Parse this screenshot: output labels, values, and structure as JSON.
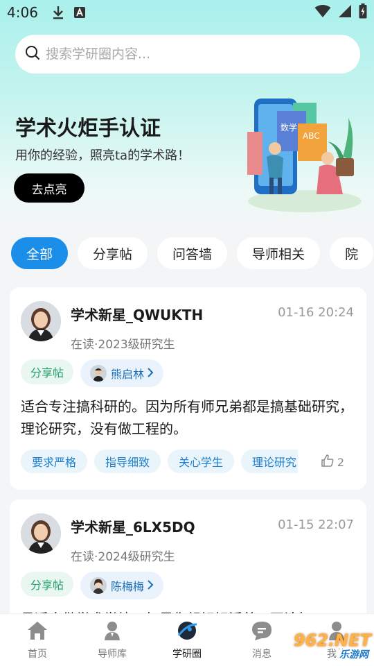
{
  "status_bar": {
    "time": "4:06"
  },
  "search": {
    "placeholder": "搜索学研圈内容..."
  },
  "banner": {
    "title": "学术火炬手认证",
    "subtitle": "用你的经验，照亮ta的学术路！",
    "button_label": "去点亮",
    "illustration_book1": "数学",
    "illustration_book2": "ABC"
  },
  "tabs": [
    {
      "label": "全部",
      "active": true
    },
    {
      "label": "分享帖",
      "active": false
    },
    {
      "label": "问答墙",
      "active": false
    },
    {
      "label": "导师相关",
      "active": false
    },
    {
      "label": "院",
      "active": false
    }
  ],
  "posts": [
    {
      "username": "学术新星_QWUKTH",
      "time": "01-16 20:24",
      "meta": "在读·2023级研究生",
      "category": "分享帖",
      "mentor": "熊启林",
      "content": "适合专注搞科研的。因为所有师兄弟都是搞基础研究，理论研究，没有做工程的。",
      "tags": [
        "要求严格",
        "指导细致",
        "关心学生",
        "理论研究"
      ],
      "likes": "2"
    },
    {
      "username": "学术新星_6LX5DQ",
      "time": "01-15 22:07",
      "meta": "在读·2024级研究生",
      "category": "分享帖",
      "mentor": "陈梅梅",
      "content": "最适合做学术学校，如果你想好好活着，不论如"
    }
  ],
  "bottom_nav": [
    {
      "label": "首页",
      "icon": "home-icon",
      "active": false
    },
    {
      "label": "导师库",
      "icon": "mentor-library-icon",
      "active": false
    },
    {
      "label": "学研圈",
      "icon": "research-circle-icon",
      "active": true
    },
    {
      "label": "消息",
      "icon": "message-icon",
      "active": false
    },
    {
      "label": "我的",
      "icon": "profile-icon",
      "active": false
    }
  ],
  "watermark": {
    "line1": "962.NET",
    "line2": "乐游网"
  },
  "colors": {
    "accent": "#1a8ee8",
    "category_green": "#23a26b",
    "tag_blue": "#1a7fd0",
    "hero_top": "#a9f0ec"
  }
}
